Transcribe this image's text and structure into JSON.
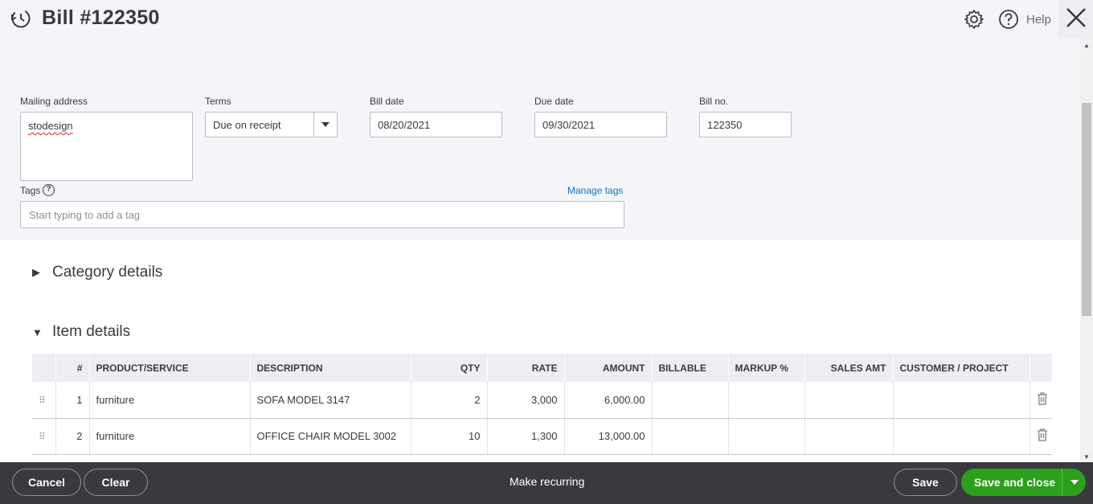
{
  "header": {
    "title": "Bill #122350",
    "help_label": "Help"
  },
  "form": {
    "mailing_address_label": "Mailing address",
    "mailing_address_value": "stodesign",
    "terms_label": "Terms",
    "terms_value": "Due on receipt",
    "bill_date_label": "Bill date",
    "bill_date_value": "08/20/2021",
    "due_date_label": "Due date",
    "due_date_value": "09/30/2021",
    "bill_no_label": "Bill no.",
    "bill_no_value": "122350",
    "tags_label": "Tags",
    "tags_placeholder": "Start typing to add a tag",
    "manage_tags": "Manage tags"
  },
  "sections": {
    "category_details": "Category details",
    "item_details": "Item details"
  },
  "table": {
    "columns": [
      "#",
      "PRODUCT/SERVICE",
      "DESCRIPTION",
      "QTY",
      "RATE",
      "AMOUNT",
      "BILLABLE",
      "MARKUP %",
      "SALES AMT",
      "CUSTOMER / PROJECT"
    ],
    "rows": [
      {
        "num": "1",
        "product": "furniture",
        "description": "SOFA MODEL 3147",
        "qty": "2",
        "rate": "3,000",
        "amount": "6,000.00"
      },
      {
        "num": "2",
        "product": "furniture",
        "description": "OFFICE CHAIR MODEL 3002",
        "qty": "10",
        "rate": "1,300",
        "amount": "13,000.00"
      }
    ]
  },
  "footer": {
    "cancel": "Cancel",
    "clear": "Clear",
    "make_recurring": "Make recurring",
    "save": "Save",
    "save_and_close": "Save and close"
  },
  "colors": {
    "primary_green": "#2ca01c",
    "footer_bg": "#393a3d",
    "link_blue": "#0077c5",
    "header_bg": "#f4f5f8"
  },
  "icons": [
    "recent-transactions-icon",
    "gear-icon",
    "help-icon",
    "close-icon",
    "help-circle-icon",
    "triangle-right-icon",
    "triangle-down-icon",
    "drag-handle-icon",
    "trash-icon",
    "chevron-down-icon"
  ]
}
